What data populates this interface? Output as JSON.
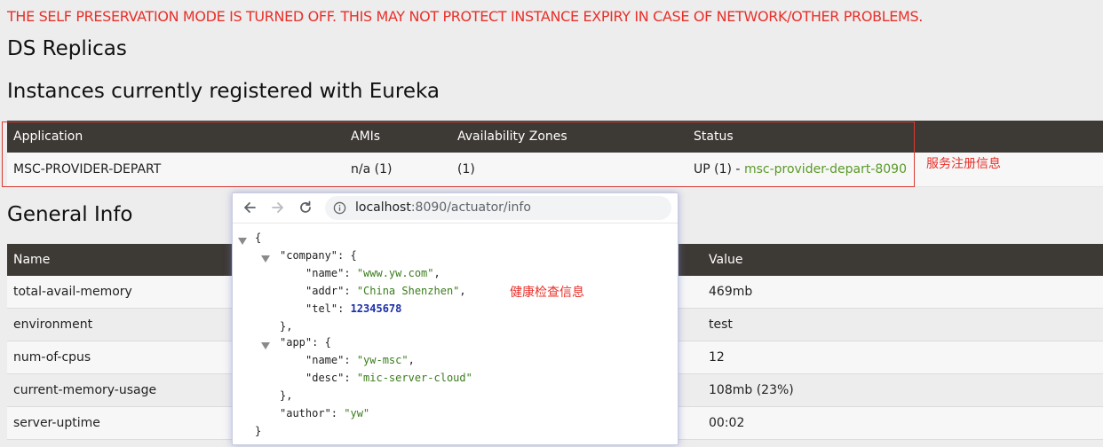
{
  "warning": "THE SELF PRESERVATION MODE IS TURNED OFF. THIS MAY NOT PROTECT INSTANCE EXPIRY IN CASE OF NETWORK/OTHER PROBLEMS.",
  "ds_title": "DS Replicas",
  "instances": {
    "title": "Instances currently registered with Eureka",
    "headers": [
      "Application",
      "AMIs",
      "Availability Zones",
      "Status"
    ],
    "row": {
      "application": "MSC-PROVIDER-DEPART",
      "amis": "n/a (1)",
      "zones": "(1)",
      "status_prefix": "UP (1) - ",
      "status_link": "msc-provider-depart-8090"
    },
    "annotation": "服务注册信息"
  },
  "general": {
    "title": "General Info",
    "headers": [
      "Name",
      "Value"
    ],
    "rows": [
      {
        "name": "total-avail-memory",
        "value": "469mb"
      },
      {
        "name": "environment",
        "value": "test"
      },
      {
        "name": "num-of-cpus",
        "value": "12"
      },
      {
        "name": "current-memory-usage",
        "value": "108mb (23%)"
      },
      {
        "name": "server-uptime",
        "value": "00:02"
      }
    ]
  },
  "popup": {
    "url_host": "localhost",
    "url_rest": ":8090/actuator/info",
    "annotation": "健康检查信息",
    "json": {
      "company_key": "\"company\"",
      "name_key": "\"name\"",
      "name_val": "\"www.yw.com\"",
      "addr_key": "\"addr\"",
      "addr_val": "\"China Shenzhen\"",
      "tel_key": "\"tel\"",
      "tel_val": "12345678",
      "app_key": "\"app\"",
      "app_name_key": "\"name\"",
      "app_name_val": "\"yw-msc\"",
      "desc_key": "\"desc\"",
      "desc_val": "\"mic-server-cloud\"",
      "author_key": "\"author\"",
      "author_val": "\"yw\""
    }
  },
  "icons": [
    "back-arrow-icon",
    "forward-arrow-icon",
    "reload-icon",
    "info-icon",
    "collapse-triangle-icon"
  ],
  "colors": {
    "warning": "#e8302a",
    "header_bg": "#3d3935",
    "link_green": "#5a9a28",
    "annotation_red": "#e8302a",
    "json_string": "#3a7d1c",
    "json_number": "#1c2fa8"
  }
}
